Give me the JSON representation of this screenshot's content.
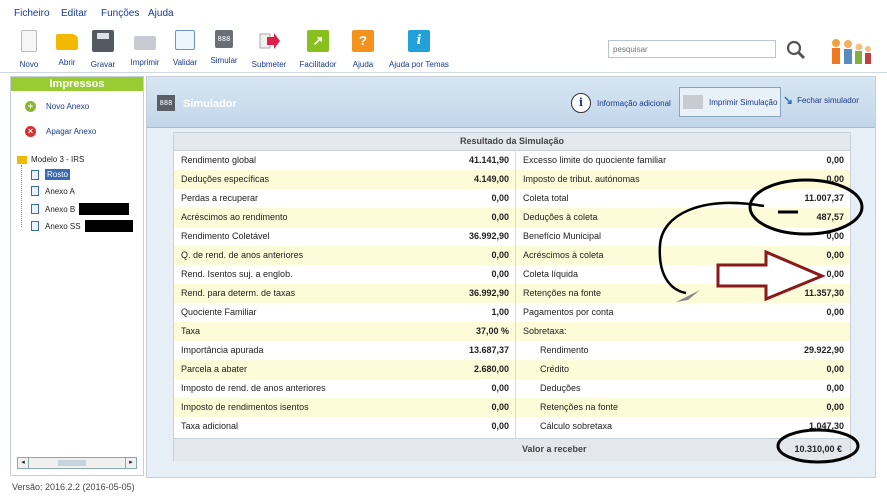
{
  "menu": [
    "Ficheiro",
    "Editar",
    "Funções",
    "Ajuda"
  ],
  "toolbar": [
    {
      "label": "Novo",
      "icon": "new-document-icon",
      "color": "#f4f4f4"
    },
    {
      "label": "Abrir",
      "icon": "open-folder-icon",
      "color": "#f5b800"
    },
    {
      "label": "Gravar",
      "icon": "save-disk-icon",
      "color": "#555a62"
    },
    {
      "label": "Imprimir",
      "icon": "printer-icon",
      "color": "#c8ccd2"
    },
    {
      "label": "Validar",
      "icon": "validate-checklist-icon",
      "color": "#6a94c8"
    },
    {
      "label": "Simular",
      "icon": "simulate-calculator-icon",
      "color": "#6a6e76"
    },
    {
      "label": "Submeter",
      "icon": "submit-arrow-icon",
      "color": "#e0204a"
    },
    {
      "label": "Facilitador",
      "icon": "facilitator-arrow-icon",
      "color": "#88c020"
    },
    {
      "label": "Ajuda",
      "icon": "help-question-icon",
      "color": "#f5921e"
    },
    {
      "label": "Ajuda por Temas",
      "icon": "info-icon",
      "color": "#22a0d8"
    }
  ],
  "search": {
    "placeholder": "pesquisar"
  },
  "left_panel": {
    "title": "Impressos",
    "actions": [
      {
        "label": "Novo Anexo"
      },
      {
        "label": "Apagar Anexo"
      }
    ],
    "tree": {
      "root": "Modelo 3 - IRS",
      "items": [
        "Rosto",
        "Anexo A",
        "Anexo B",
        "Anexo SS"
      ]
    }
  },
  "version": "Versão: 2016.2.2 (2016-05-05)",
  "simulator": {
    "title": "Simulador",
    "buttons": [
      {
        "label": "Informação adicional"
      },
      {
        "label": "Imprimir Simulação"
      },
      {
        "label": "Fechar simulador"
      }
    ],
    "result_title": "Resultado da Simulação",
    "left_rows": [
      {
        "label": "Rendimento global",
        "value": "41.141,90"
      },
      {
        "label": "Deduções específicas",
        "value": "4.149,00"
      },
      {
        "label": "Perdas a recuperar",
        "value": "0,00"
      },
      {
        "label": "Acréscimos ao rendimento",
        "value": "0,00"
      },
      {
        "label": "Rendimento Coletável",
        "value": "36.992,90"
      },
      {
        "label": "Q. de rend. de anos anteriores",
        "value": "0,00"
      },
      {
        "label": "Rend. Isentos suj. a englob.",
        "value": "0,00"
      },
      {
        "label": "Rend. para determ. de taxas",
        "value": "36.992,90"
      },
      {
        "label": "Quociente Familiar",
        "value": "1,00"
      },
      {
        "label": "Taxa",
        "value": "37,00 %"
      },
      {
        "label": "Importância apurada",
        "value": "13.687,37"
      },
      {
        "label": "Parcela a abater",
        "value": "2.680,00"
      },
      {
        "label": "Imposto de rend. de anos anteriores",
        "value": "0,00"
      },
      {
        "label": "Imposto de rendimentos isentos",
        "value": "0,00"
      },
      {
        "label": "Taxa adicional",
        "value": "0,00"
      }
    ],
    "right_rows": [
      {
        "label": "Excesso limite do quociente familiar",
        "value": "0,00",
        "indent": false
      },
      {
        "label": "Imposto de tribut. autónomas",
        "value": "0,00",
        "indent": false
      },
      {
        "label": "Coleta total",
        "value": "11.007,37",
        "indent": false
      },
      {
        "label": "Deduções à coleta",
        "value": "487,57",
        "indent": false
      },
      {
        "label": "Benefício Municipal",
        "value": "0,00",
        "indent": false
      },
      {
        "label": "Acréscimos à coleta",
        "value": "0,00",
        "indent": false
      },
      {
        "label": "Coleta líquida",
        "value": "0,00",
        "indent": false
      },
      {
        "label": "Retenções na fonte",
        "value": "11.357,30",
        "indent": false
      },
      {
        "label": "Pagamentos por conta",
        "value": "0,00",
        "indent": false
      },
      {
        "label": "Sobretaxa:",
        "value": "",
        "indent": false
      },
      {
        "label": "Rendimento",
        "value": "29.922,90",
        "indent": true
      },
      {
        "label": "Crédito",
        "value": "0,00",
        "indent": true
      },
      {
        "label": "Deduções",
        "value": "0,00",
        "indent": true
      },
      {
        "label": "Retenções na fonte",
        "value": "0,00",
        "indent": true
      },
      {
        "label": "Cálculo sobretaxa",
        "value": "1.047,30",
        "indent": true
      }
    ],
    "total": {
      "label": "Valor a receber",
      "value": "10.310,00 €"
    }
  },
  "colors": {
    "accent_green": "#99cc33",
    "row_highlight": "#fdfbd8",
    "annotation_red": "#8a1a1a",
    "annotation_black": "#000000"
  }
}
